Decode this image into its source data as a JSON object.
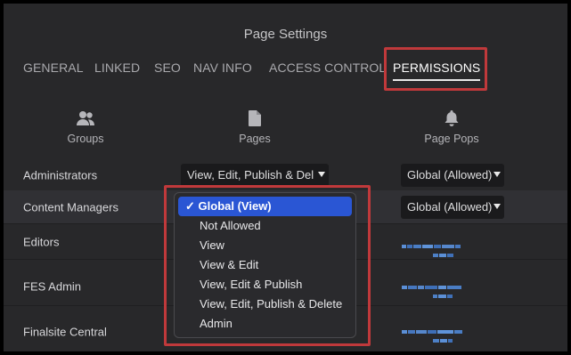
{
  "dialog": {
    "title": "Page Settings"
  },
  "tabs": [
    {
      "label": "GENERAL"
    },
    {
      "label": "LINKED"
    },
    {
      "label": "SEO"
    },
    {
      "label": "NAV INFO"
    },
    {
      "label": "ACCESS CONTROL"
    },
    {
      "label": "PERMISSIONS"
    }
  ],
  "active_tab": "PERMISSIONS",
  "columns": {
    "groups": {
      "label": "Groups",
      "icon": "groups-icon"
    },
    "pages": {
      "label": "Pages",
      "icon": "page-icon"
    },
    "page_pops": {
      "label": "Page Pops",
      "icon": "bell-icon"
    }
  },
  "rows": [
    {
      "group": "Administrators",
      "pages": "View, Edit, Publish & Del",
      "page_pops": "Global (Allowed)"
    },
    {
      "group": "Content Managers",
      "pages": "",
      "page_pops": "Global (Allowed)"
    },
    {
      "group": "Editors"
    },
    {
      "group": "FES Admin"
    },
    {
      "group": "Finalsite Central"
    }
  ],
  "dropdown": {
    "selected": "Global (View)",
    "check_mark": "✓",
    "options": [
      "Global (View)",
      "Not Allowed",
      "View",
      "View & Edit",
      "View, Edit & Publish",
      "View, Edit, Publish & Delete",
      "Admin"
    ]
  },
  "colors": {
    "highlight_box": "#c0393b",
    "selected_option": "#2a56d4",
    "panel_bg": "#28282a",
    "blurred_text": "#5b8fd6"
  }
}
